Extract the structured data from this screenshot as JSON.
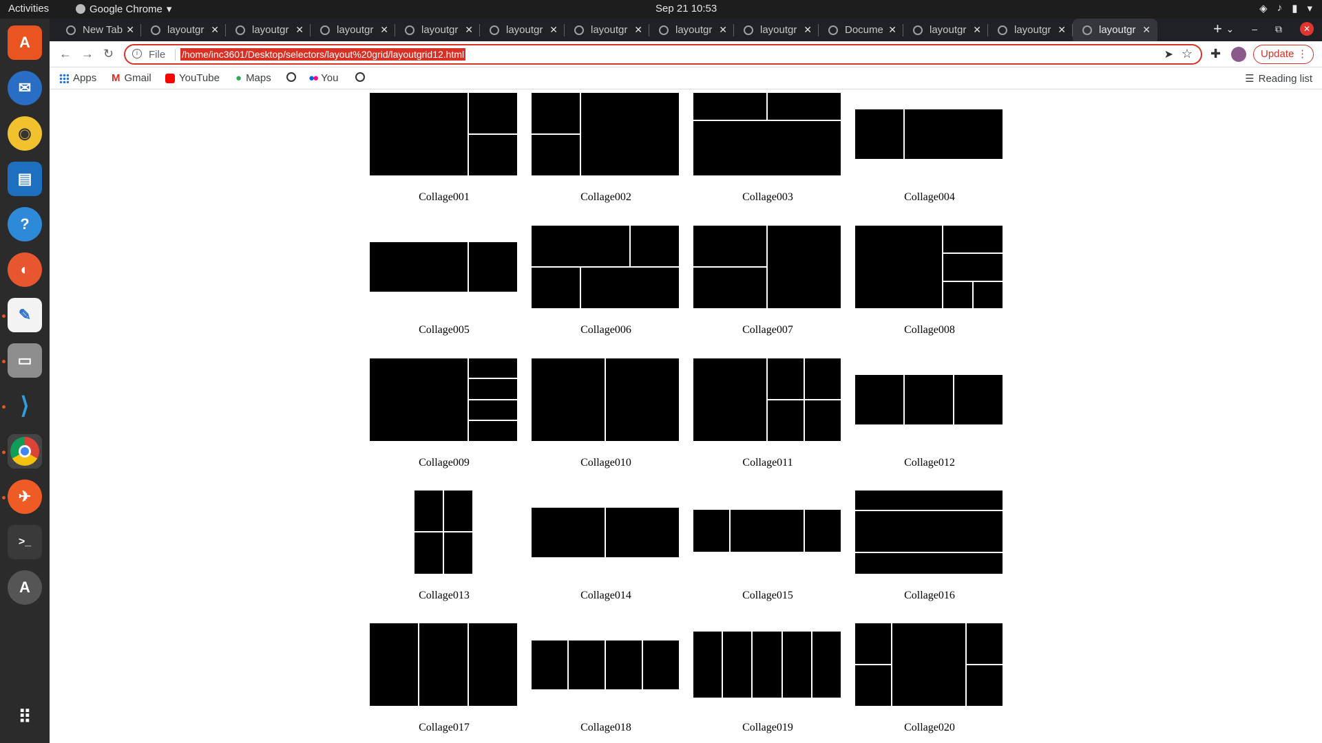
{
  "system": {
    "activities": "Activities",
    "app_name": "Google Chrome",
    "clock": "Sep 21  10:53"
  },
  "browser": {
    "tabs": [
      {
        "title": "New Tab"
      },
      {
        "title": "layoutgr"
      },
      {
        "title": "layoutgr"
      },
      {
        "title": "layoutgr"
      },
      {
        "title": "layoutgr"
      },
      {
        "title": "layoutgr"
      },
      {
        "title": "layoutgr"
      },
      {
        "title": "layoutgr"
      },
      {
        "title": "layoutgr"
      },
      {
        "title": "Docume"
      },
      {
        "title": "layoutgr"
      },
      {
        "title": "layoutgr"
      },
      {
        "title": "layoutgr"
      }
    ],
    "active_tab_index": 12,
    "omnibox": {
      "scheme_label": "File",
      "url": "/home/inc3601/Desktop/selectors/layout%20grid/layoutgrid12.html"
    },
    "update_label": "Update",
    "bookmarks": [
      {
        "label": "Apps",
        "icon": "apps-grid-icon"
      },
      {
        "label": "Gmail",
        "icon": "gmail-icon"
      },
      {
        "label": "YouTube",
        "icon": "youtube-icon"
      },
      {
        "label": "Maps",
        "icon": "maps-icon"
      },
      {
        "label": "",
        "icon": "globe-icon"
      },
      {
        "label": "You",
        "icon": "flickr-icon"
      },
      {
        "label": "",
        "icon": "globe-icon"
      }
    ],
    "reading_list": "Reading list"
  },
  "page": {
    "collages": [
      {
        "label": "Collage001"
      },
      {
        "label": "Collage002"
      },
      {
        "label": "Collage003"
      },
      {
        "label": "Collage004"
      },
      {
        "label": "Collage005"
      },
      {
        "label": "Collage006"
      },
      {
        "label": "Collage007"
      },
      {
        "label": "Collage008"
      },
      {
        "label": "Collage009"
      },
      {
        "label": "Collage010"
      },
      {
        "label": "Collage011"
      },
      {
        "label": "Collage012"
      },
      {
        "label": "Collage013"
      },
      {
        "label": "Collage014"
      },
      {
        "label": "Collage015"
      },
      {
        "label": "Collage016"
      },
      {
        "label": "Collage017"
      },
      {
        "label": "Collage018"
      },
      {
        "label": "Collage019"
      },
      {
        "label": "Collage020"
      }
    ]
  },
  "dock": {
    "apps": [
      "ubuntu-software-icon",
      "thunderbird-icon",
      "rhythmbox-icon",
      "writer-icon",
      "help-icon",
      "firefox-icon",
      "text-editor-icon",
      "files-icon",
      "vscode-icon",
      "chrome-icon",
      "postman-icon",
      "terminal-icon",
      "software-updater-icon",
      "show-apps-icon"
    ]
  }
}
